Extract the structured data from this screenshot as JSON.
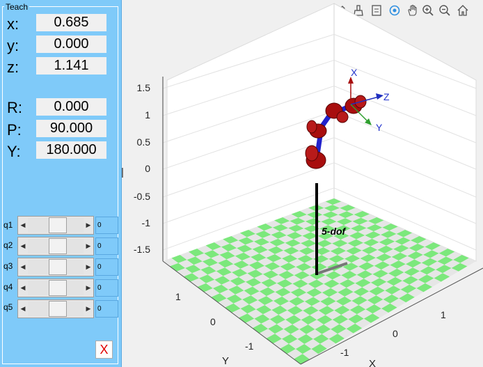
{
  "teach": {
    "title": "Teach",
    "pose": [
      {
        "label": "x:",
        "value": "0.685"
      },
      {
        "label": "y:",
        "value": "0.000"
      },
      {
        "label": "z:",
        "value": "1.141"
      },
      {
        "label": "R:",
        "value": "0.000"
      },
      {
        "label": "P:",
        "value": "90.000"
      },
      {
        "label": "Y:",
        "value": "180.000"
      }
    ],
    "joints": [
      {
        "label": "q1",
        "value": "0"
      },
      {
        "label": "q2",
        "value": "0"
      },
      {
        "label": "q3",
        "value": "0"
      },
      {
        "label": "q4",
        "value": "0"
      },
      {
        "label": "q5",
        "value": "0"
      }
    ],
    "close_label": "X"
  },
  "toolbar": {
    "icons": [
      "edit-icon",
      "brush-icon",
      "legend-icon",
      "rotate-3d-icon",
      "pan-hand-icon",
      "zoom-in-icon",
      "zoom-out-icon",
      "home-icon"
    ]
  },
  "plot": {
    "z_ticks": [
      "1.5",
      "1",
      "0.5",
      "0",
      "-0.5",
      "-1",
      "-1.5"
    ],
    "y_ticks": [
      "1",
      "0",
      "-1"
    ],
    "x_ticks": [
      "-1",
      "0",
      "1"
    ],
    "x_label": "X",
    "y_label": "Y",
    "z_label": "|",
    "robot_name": "5-dof",
    "frame_labels": {
      "x": "X",
      "y": "Y",
      "z": "Z"
    },
    "floor_colors": {
      "a": "#7ce87c",
      "b": "#e6e6e6"
    },
    "link_color": "#a80e0e",
    "joint_link_color": "#2222cc"
  }
}
